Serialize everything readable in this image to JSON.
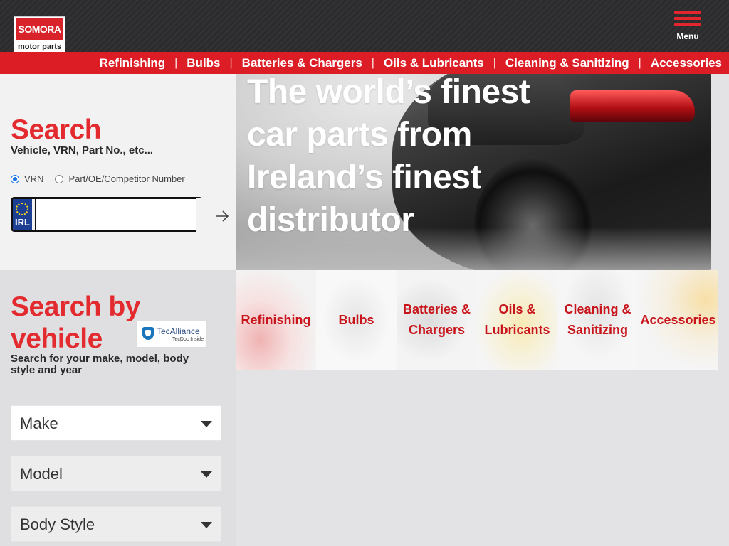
{
  "header": {
    "logo_top": "SOMORA",
    "logo_bottom": "motor parts",
    "menu_label": "Menu"
  },
  "nav": {
    "items": [
      "Refinishing",
      "Bulbs",
      "Batteries & Chargers",
      "Oils & Lubricants",
      "Cleaning & Sanitizing",
      "Accessories"
    ],
    "separator": "|"
  },
  "search": {
    "title": "Search",
    "subtitle": "Vehicle, VRN, Part No., etc...",
    "radio_vrn": "VRN",
    "radio_part": "Part/OE/Competitor Number",
    "selected": "VRN",
    "plate_country": "IRL",
    "input_value": ""
  },
  "hero": {
    "title": "The world’s finest car parts from Ireland’s finest distributor"
  },
  "vehicle": {
    "title": "Search by vehicle",
    "badge_name": "TecAlliance",
    "badge_sub": "TecDoc Inside",
    "subtitle": "Search for your make, model, body style and year",
    "make": "Make",
    "model": "Model",
    "body_style": "Body Style"
  },
  "tiles": {
    "refinishing": "Refinishing",
    "bulbs": "Bulbs",
    "batteries_1": "Batteries &",
    "batteries_2": "Chargers",
    "oils_1": "Oils &",
    "oils_2": "Lubricants",
    "cleaning_1": "Cleaning &",
    "cleaning_2": "Sanitizing",
    "accessories": "Accessories"
  },
  "colors": {
    "brand_red": "#dc1d25",
    "title_red": "#e32a2f",
    "header_dark": "#2b2b2d"
  }
}
